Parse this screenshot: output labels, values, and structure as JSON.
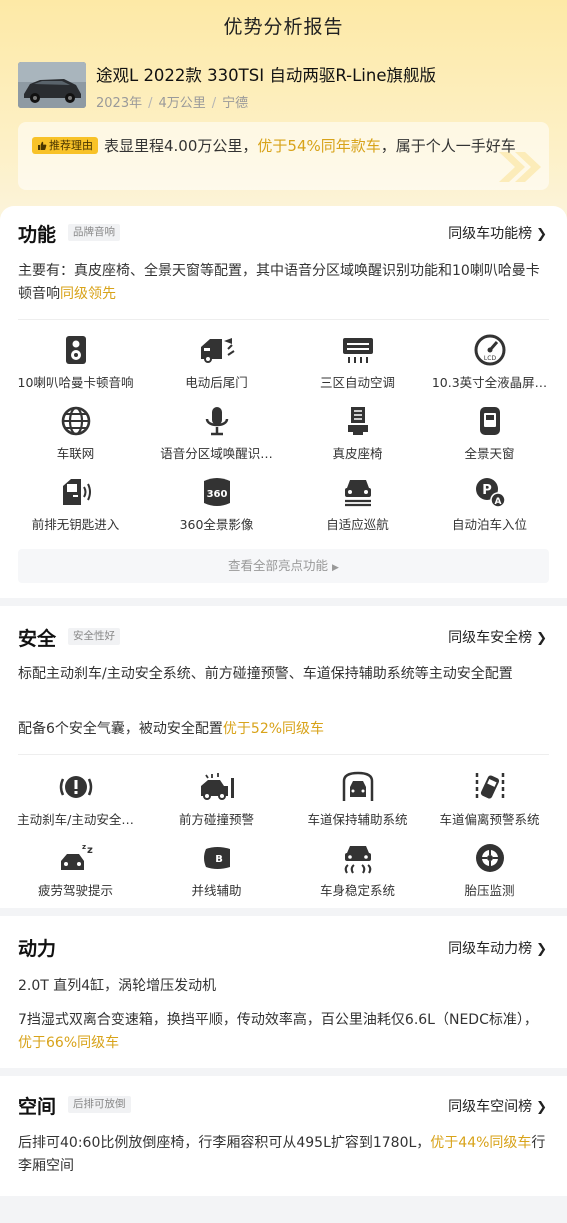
{
  "header": {
    "title": "优势分析报告"
  },
  "car": {
    "name": "途观L 2022款 330TSI 自动两驱R-Line旗舰版",
    "year": "2023年",
    "mileage": "4万公里",
    "city": "宁德",
    "meta_sep": "/"
  },
  "reason": {
    "badge": "推荐理由",
    "text_a": "表显里程4.00万公里，",
    "text_hl": "优于54%同年款车",
    "text_b": "，属于个人一手好车"
  },
  "features": {
    "title": "功能",
    "tag": "品牌音响",
    "link": "同级车功能榜",
    "summary_a": "主要有：真皮座椅、全景天窗等配置，其中语音分区域唤醒识别功能和10喇叭哈曼卡顿音响",
    "summary_hl": "同级领先",
    "items": [
      {
        "label": "10喇叭哈曼卡顿音响",
        "icon": "speaker-icon"
      },
      {
        "label": "电动后尾门",
        "icon": "power-tailgate-icon"
      },
      {
        "label": "三区自动空调",
        "icon": "air-conditioner-icon"
      },
      {
        "label": "10.3英寸全液晶屏…",
        "icon": "lcd-dashboard-icon"
      },
      {
        "label": "车联网",
        "icon": "globe-icon"
      },
      {
        "label": "语音分区域唤醒识…",
        "icon": "microphone-icon"
      },
      {
        "label": "真皮座椅",
        "icon": "leather-seat-icon"
      },
      {
        "label": "全景天窗",
        "icon": "sunroof-icon"
      },
      {
        "label": "前排无钥匙进入",
        "icon": "keyless-entry-icon"
      },
      {
        "label": "360全景影像",
        "icon": "camera-360-icon"
      },
      {
        "label": "自适应巡航",
        "icon": "adaptive-cruise-icon"
      },
      {
        "label": "自动泊车入位",
        "icon": "auto-parking-icon"
      }
    ],
    "more": "查看全部亮点功能"
  },
  "safety": {
    "title": "安全",
    "tag": "安全性好",
    "link": "同级车安全榜",
    "line1": "标配主动刹车/主动安全系统、前方碰撞预警、车道保持辅助系统等主动安全配置",
    "line2_a": "配备6个安全气囊，被动安全配置",
    "line2_hl": "优于52%同级车",
    "items": [
      {
        "label": "主动刹车/主动安全…",
        "icon": "brake-warning-icon"
      },
      {
        "label": "前方碰撞预警",
        "icon": "collision-warning-icon"
      },
      {
        "label": "车道保持辅助系统",
        "icon": "lane-keep-icon"
      },
      {
        "label": "车道偏离预警系统",
        "icon": "lane-departure-icon"
      },
      {
        "label": "疲劳驾驶提示",
        "icon": "fatigue-alert-icon"
      },
      {
        "label": "并线辅助",
        "icon": "blind-spot-icon"
      },
      {
        "label": "车身稳定系统",
        "icon": "stability-control-icon"
      },
      {
        "label": "胎压监测",
        "icon": "tire-pressure-icon"
      }
    ]
  },
  "power": {
    "title": "动力",
    "link": "同级车动力榜",
    "line1": "2.0T 直列4缸，涡轮增压发动机",
    "line2_a": "7挡湿式双离合变速箱，换挡平顺，传动效率高，百公里油耗仅6.6L（NEDC标准），",
    "line2_hl": "优于66%同级车"
  },
  "space": {
    "title": "空间",
    "tag": "后排可放倒",
    "link": "同级车空间榜",
    "line_a": "后排可40:60比例放倒座椅，行李厢容积可从495L扩容到1780L，",
    "line_hl": "优于44%同级车",
    "line_b": "行李厢空间"
  },
  "colors": {
    "accent": "#d8a31a",
    "badge": "#f8c228",
    "hero_top": "#fde9a6"
  }
}
